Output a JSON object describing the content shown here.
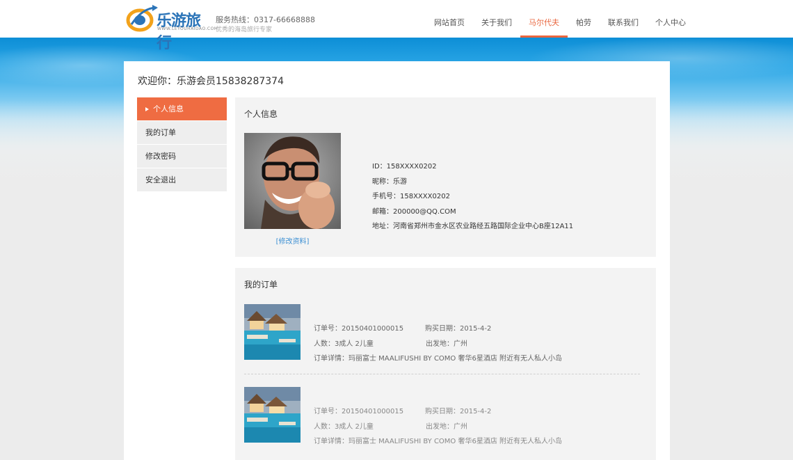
{
  "header": {
    "logo_text": "乐游旅行",
    "logo_sub": "WWW.LEYOUHAIDAO.COM",
    "hotline": "服务热线：0317-66668888",
    "tagline": "优秀的海岛旅行专家",
    "nav": [
      {
        "label": "网站首页",
        "active": false
      },
      {
        "label": "关于我们",
        "active": false
      },
      {
        "label": "马尔代夫",
        "active": true
      },
      {
        "label": "帕劳",
        "active": false
      },
      {
        "label": "联系我们",
        "active": false
      },
      {
        "label": "个人中心",
        "active": false
      }
    ],
    "accent_color": "#e9663e"
  },
  "welcome": "欢迎你：乐游会员15838287374",
  "sidebar": {
    "items": [
      {
        "label": "个人信息",
        "active": true
      },
      {
        "label": "我的订单",
        "active": false
      },
      {
        "label": "修改密码",
        "active": false
      },
      {
        "label": "安全退出",
        "active": false
      }
    ]
  },
  "profile": {
    "title": "个人信息",
    "edit_link": "[修改资料]",
    "lines": [
      "ID：158XXXX0202",
      "昵称：乐游",
      "手机号：158XXXX0202",
      "邮箱：200000@QQ.COM",
      "地址：河南省郑州市金水区农业路经五路国际企业中心B座12A11"
    ]
  },
  "orders": {
    "title": "我的订单",
    "items": [
      {
        "order_no": "订单号：20150401000015",
        "date": "购买日期：2015-4-2",
        "people": "人数：3成人 2儿童",
        "origin": "出发地：广州",
        "detail": "订单详情：玛丽富士 MAALIFUSHI BY COMO 奢华6星酒店 附近有无人私人小岛"
      },
      {
        "order_no": "订单号：20150401000015",
        "date": "购买日期：2015-4-2",
        "people": "人数：3成人 2儿童",
        "origin": "出发地：广州",
        "detail": "订单详情：玛丽富士 MAALIFUSHI BY COMO 奢华6星酒店 附近有无人私人小岛"
      }
    ]
  }
}
